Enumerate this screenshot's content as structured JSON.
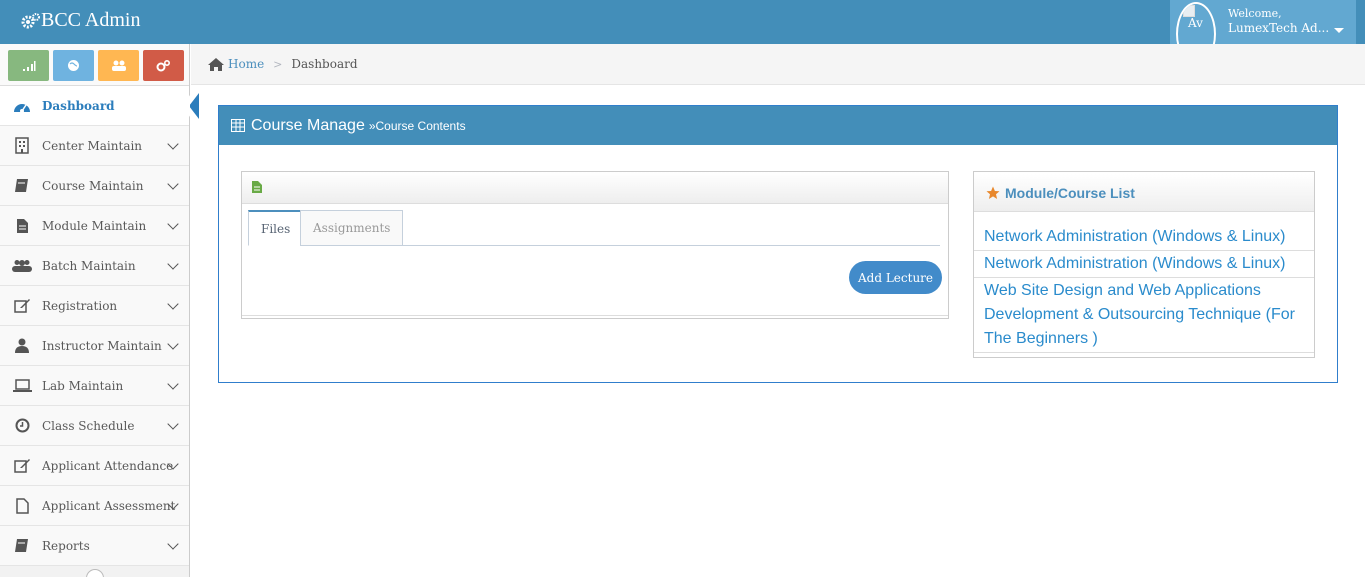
{
  "app": {
    "brand": "BCC Admin"
  },
  "user": {
    "avatar_alt": "Av",
    "welcome": "Welcome,",
    "name": "LumexTech Ad..."
  },
  "sidebar": {
    "shortcuts": [
      "stats",
      "globe",
      "users",
      "cogs"
    ],
    "items": [
      {
        "label": "Dashboard",
        "icon": "dashboard-icon"
      },
      {
        "label": "Center Maintain",
        "icon": "building-icon"
      },
      {
        "label": "Course Maintain",
        "icon": "book-icon"
      },
      {
        "label": "Module Maintain",
        "icon": "file-text-icon"
      },
      {
        "label": "Batch Maintain",
        "icon": "group-icon"
      },
      {
        "label": "Registration",
        "icon": "edit-icon"
      },
      {
        "label": "Instructor Maintain",
        "icon": "user-icon"
      },
      {
        "label": "Lab Maintain",
        "icon": "laptop-icon"
      },
      {
        "label": "Class Schedule",
        "icon": "clock-icon"
      },
      {
        "label": "Applicant Attendance",
        "icon": "edit-icon"
      },
      {
        "label": "Applicant Assessment",
        "icon": "file-icon"
      },
      {
        "label": "Reports",
        "icon": "book-icon"
      }
    ]
  },
  "breadcrumb": {
    "home": "Home",
    "current": "Dashboard"
  },
  "widget": {
    "title": "Course Manage",
    "sub": "»Course Contents"
  },
  "files": {
    "tabs": [
      "Files",
      "Assignments"
    ],
    "add_button": "Add Lecture"
  },
  "module_list": {
    "title": "Module/Course List",
    "items": [
      "Network Administration (Windows & Linux)",
      "Network Administration (Windows & Linux)",
      "Web Site Design and Web Applications Development & Outsourcing Technique (For The Beginners )"
    ]
  },
  "colors": {
    "navbar": "#438eb9",
    "accent": "#2b7dbc",
    "button": "#428bca"
  }
}
